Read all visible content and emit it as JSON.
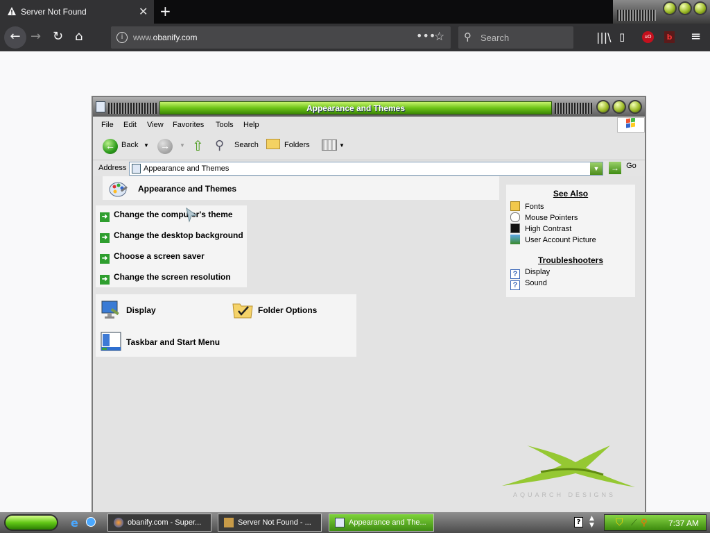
{
  "browser": {
    "tab_title": "Server Not Found",
    "url_prefix": "www.",
    "url_domain": "obanify.com",
    "search_placeholder": "Search"
  },
  "window": {
    "title": "Appearance and Themes",
    "menu": [
      "File",
      "Edit",
      "View",
      "Favorites",
      "Tools",
      "Help"
    ],
    "toolbar": {
      "back": "Back",
      "search": "Search",
      "folders": "Folders"
    },
    "address_label": "Address",
    "address_value": "Appearance and Themes",
    "go_label": "Go"
  },
  "content": {
    "header": "Appearance and Themes",
    "tasks": [
      "Change the computer's theme",
      "Change the desktop background",
      "Choose a screen saver",
      "Change the screen resolution"
    ],
    "applets": [
      "Display",
      "Folder Options",
      "Taskbar and Start Menu"
    ],
    "see_also_title": "See Also",
    "see_also": [
      "Fonts",
      "Mouse Pointers",
      "High Contrast",
      "User Account Picture"
    ],
    "troubleshooters_title": "Troubleshooters",
    "troubleshooters": [
      "Display",
      "Sound"
    ],
    "logo_caption": "AQUARCH DESIGNS"
  },
  "taskbar": {
    "buttons": [
      "obanify.com - Super...",
      "Server Not Found - ...",
      "Appearance and The..."
    ],
    "clock": "7:37 AM"
  },
  "colors": {
    "accent_green": "#6ec418",
    "firefox_dark": "#323234"
  }
}
